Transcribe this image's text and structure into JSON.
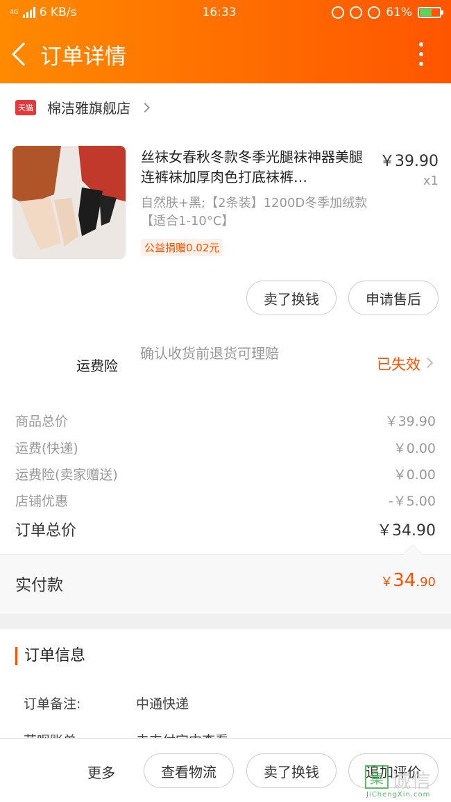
{
  "status_bar": {
    "network": "4G",
    "speed": "6 KB/s",
    "time": "16:33",
    "battery": "61%",
    "battery_level": 0.61
  },
  "header": {
    "title": "订单详情"
  },
  "shop": {
    "badge": "天猫",
    "name": "棉洁雅旗舰店"
  },
  "product": {
    "title": "丝袜女春秋冬款冬季光腿袜神器美腿连裤袜加厚肉色打底袜裤…",
    "price": "￥39.90",
    "qty": "x1",
    "spec": "自然肤+黑;【2条装】1200D冬季加绒款【适合1-10°C】",
    "charity_tag": "公益捐赠0.02元"
  },
  "item_actions": {
    "resell": "卖了换钱",
    "after_sale": "申请售后"
  },
  "insurance": {
    "label": "运费险",
    "desc": "确认收货前退货可理赔",
    "status": "已失效"
  },
  "costs": [
    {
      "label": "商品总价",
      "value": "￥39.90"
    },
    {
      "label": "运费(快递)",
      "value": "￥0.00"
    },
    {
      "label": "运费险(卖家赠送)",
      "value": "￥0.00"
    },
    {
      "label": "店铺优惠",
      "value": "-￥5.00"
    }
  ],
  "order_total": {
    "label": "订单总价",
    "value": "￥34.90"
  },
  "paid": {
    "label": "实付款",
    "currency": "￥",
    "int": "34",
    "dec": ".90"
  },
  "order_info": {
    "title": "订单信息",
    "rows": [
      {
        "label": "订单备注:",
        "value": "中通快递"
      },
      {
        "label": "花呗账单",
        "value": "去支付宝中查看"
      }
    ]
  },
  "bottom_bar": {
    "more": "更多",
    "logistics": "查看物流",
    "resell": "卖了换钱",
    "review": "追加评价"
  },
  "watermark": {
    "cn": "诚信",
    "en": "JiChengXin.com",
    "mark": "集"
  },
  "colors": {
    "accent": "#ff5000",
    "header_start": "#ff8a00",
    "header_end": "#ff5500"
  }
}
